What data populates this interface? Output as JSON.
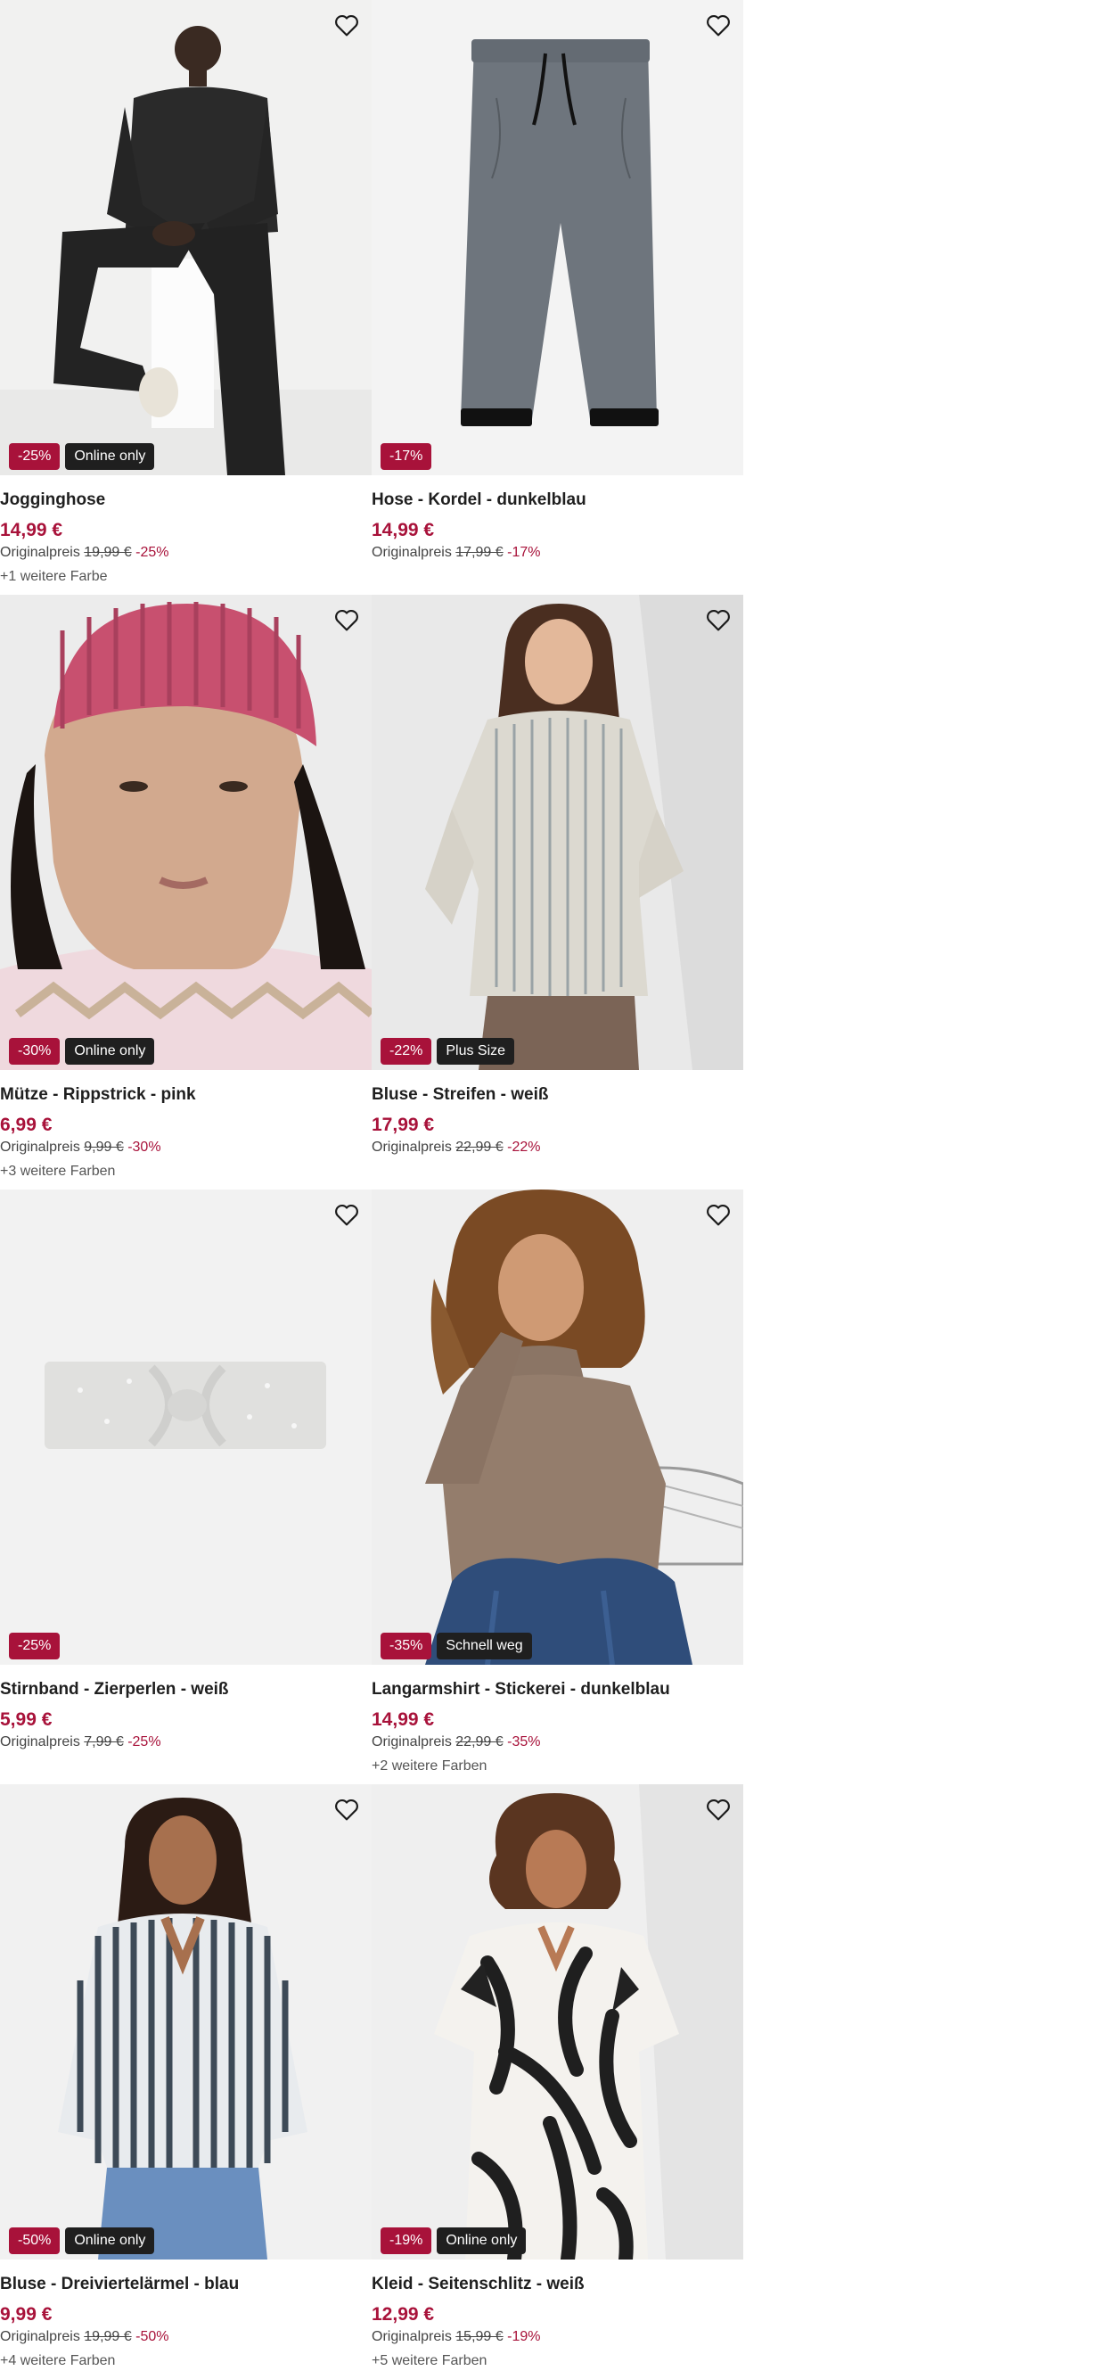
{
  "labels": {
    "original_price": "Originalpreis"
  },
  "colors": {
    "accent": "#a8123a",
    "badge_dark": "#1f1f1f",
    "image_bg": "#f3f3f3"
  },
  "products": [
    {
      "name": "Jogginghose",
      "price": "14,99 €",
      "original_price": "19,99 €",
      "discount": "-25%",
      "flag": "Online only",
      "more_colors": "+1 weitere Farbe",
      "image": "man-black-jogging-suit"
    },
    {
      "name": "Hose - Kordel - dunkelblau",
      "price": "14,99 €",
      "original_price": "17,99 €",
      "discount": "-17%",
      "flag": "",
      "more_colors": "",
      "image": "grey-trousers"
    },
    {
      "name": "Mütze - Rippstrick - pink",
      "price": "6,99 €",
      "original_price": "9,99 €",
      "discount": "-30%",
      "flag": "Online only",
      "more_colors": "+3 weitere Farben",
      "image": "woman-pink-beanie"
    },
    {
      "name": "Bluse - Streifen - weiß",
      "price": "17,99 €",
      "original_price": "22,99 €",
      "discount": "-22%",
      "flag": "Plus Size",
      "more_colors": "",
      "image": "woman-striped-blouse"
    },
    {
      "name": "Stirnband - Zierperlen - weiß",
      "price": "5,99 €",
      "original_price": "7,99 €",
      "discount": "-25%",
      "flag": "",
      "more_colors": "",
      "image": "white-headband"
    },
    {
      "name": "Langarmshirt - Stickerei - dunkelblau",
      "price": "14,99 €",
      "original_price": "22,99 €",
      "discount": "-35%",
      "flag": "Schnell weg",
      "more_colors": "+2 weitere Farben",
      "image": "woman-taupe-longsleeve"
    },
    {
      "name": "Bluse - Dreiviertelärmel - blau",
      "price": "9,99 €",
      "original_price": "19,99 €",
      "discount": "-50%",
      "flag": "Online only",
      "more_colors": "+4 weitere Farben",
      "image": "woman-striped-blouse-blue"
    },
    {
      "name": "Kleid - Seitenschlitz - weiß",
      "price": "12,99 €",
      "original_price": "15,99 €",
      "discount": "-19%",
      "flag": "Online only",
      "more_colors": "+5 weitere Farben",
      "image": "woman-palm-print-dress"
    }
  ]
}
